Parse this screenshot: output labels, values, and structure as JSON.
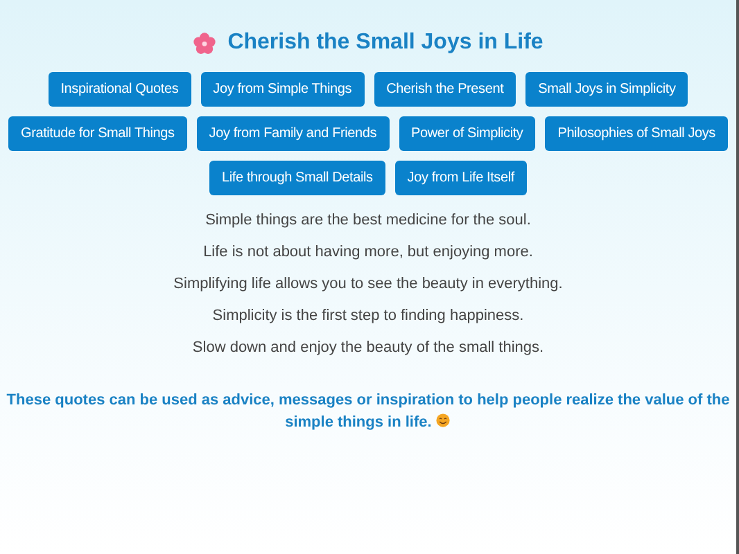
{
  "title": "Cherish the Small Joys in Life",
  "categories": [
    "Inspirational Quotes",
    "Joy from Simple Things",
    "Cherish the Present",
    "Small Joys in Simplicity",
    "Gratitude for Small Things",
    "Joy from Family and Friends",
    "Power of Simplicity",
    "Philosophies of Small Joys",
    "Life through Small Details",
    "Joy from Life Itself"
  ],
  "quotes": [
    "Simple things are the best medicine for the soul.",
    "Life is not about having more, but enjoying more.",
    "Simplifying life allows you to see the beauty in everything.",
    "Simplicity is the first step to finding happiness.",
    "Slow down and enjoy the beauty of the small things."
  ],
  "note_lines": [
    "These quotes can be used as advice, messages or inspiration to help people realize the value of the",
    "simple things in life."
  ]
}
